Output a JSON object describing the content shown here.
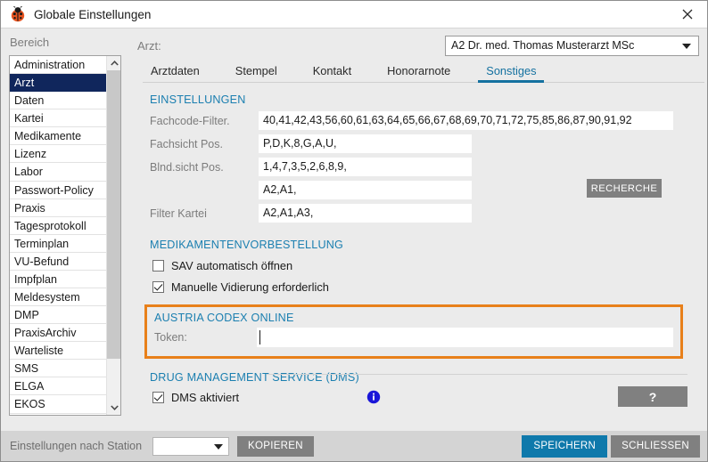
{
  "window": {
    "title": "Globale Einstellungen",
    "app_icon": "ladybug-icon",
    "close_icon": "close-icon"
  },
  "sidebar": {
    "label": "Bereich",
    "selected": "Arzt",
    "items": [
      "Administration",
      "Arzt",
      "Daten",
      "Kartei",
      "Medikamente",
      "Lizenz",
      "Labor",
      "Passwort-Policy",
      "Praxis",
      "Tagesprotokoll",
      "Terminplan",
      "VU-Befund",
      "Impfplan",
      "Meldesystem",
      "DMP",
      "PraxisArchiv",
      "Warteliste",
      "SMS",
      "ELGA",
      "EKOS"
    ]
  },
  "header": {
    "arzt_label": "Arzt:",
    "arzt_value": "A2 Dr. med. Thomas Musterarzt MSc"
  },
  "tabs": [
    {
      "label": "Arztdaten",
      "active": false
    },
    {
      "label": "Stempel",
      "active": false
    },
    {
      "label": "Kontakt",
      "active": false
    },
    {
      "label": "Honorarnote",
      "active": false
    },
    {
      "label": "Sonstiges",
      "active": true
    }
  ],
  "einstellungen": {
    "title": "EINSTELLUNGEN",
    "fields": [
      {
        "label": "Fachcode-Filter.",
        "value": "40,41,42,43,56,60,61,63,64,65,66,67,68,69,70,71,72,75,85,86,87,90,91,92"
      },
      {
        "label": "Fachsicht Pos.",
        "value": "P,D,K,8,G,A,U,"
      },
      {
        "label": "Blnd.sicht Pos.",
        "value": "1,4,7,3,5,2,6,8,9,"
      },
      {
        "label": "",
        "value": "A2,A1,"
      },
      {
        "label": "Filter Kartei",
        "value": "A2,A1,A3,"
      }
    ],
    "recherche_button": "RECHERCHE"
  },
  "medikamentenvorbestellung": {
    "title": "MEDIKAMENTENVORBESTELLUNG",
    "checkboxes": [
      {
        "label": "SAV automatisch öffnen",
        "checked": false
      },
      {
        "label": "Manuelle Vidierung erforderlich",
        "checked": true
      }
    ]
  },
  "austria_codex": {
    "title": "AUSTRIA CODEX ONLINE",
    "token_label": "Token:",
    "token_value": "",
    "highlight_color": "#e8801a"
  },
  "dms": {
    "title": "DRUG MANAGEMENT SERVICE (DMS)",
    "checkbox": {
      "label": "DMS aktiviert",
      "checked": true
    },
    "info_icon": "info-icon"
  },
  "help_button": "?",
  "footer": {
    "station_label": "Einstellungen nach Station",
    "station_value": "",
    "kopieren_button": "KOPIEREN",
    "speichern_button": "SPEICHERN",
    "schliessen_button": "SCHLIESSEN",
    "accent_color": "#0f79ab"
  }
}
